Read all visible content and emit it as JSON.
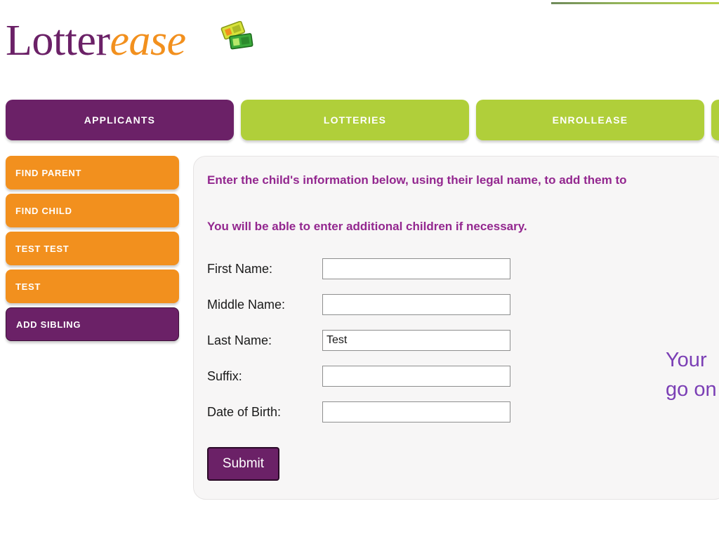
{
  "brand": {
    "logo_part_1": "Lotter",
    "logo_part_2": "ease",
    "ticket_icon": "lottery-ticket-icon"
  },
  "colors": {
    "purple": "#6b2167",
    "green": "#b0cf3a",
    "orange": "#f2901e",
    "heading_magenta": "#93278f",
    "note_purple": "#7b3fb5",
    "panel_bg": "#f7f6f6"
  },
  "tabs": [
    {
      "label": "APPLICANTS",
      "state": "active",
      "color": "purple"
    },
    {
      "label": "LOTTERIES",
      "state": "inactive",
      "color": "green"
    },
    {
      "label": "ENROLLEASE",
      "state": "inactive",
      "color": "green"
    },
    {
      "label": "",
      "state": "inactive",
      "color": "green"
    }
  ],
  "sidebar": {
    "items": [
      {
        "label": "FIND PARENT",
        "state": "inactive",
        "color": "orange"
      },
      {
        "label": "FIND CHILD",
        "state": "inactive",
        "color": "orange"
      },
      {
        "label": "TEST TEST",
        "state": "inactive",
        "color": "orange"
      },
      {
        "label": "TEST",
        "state": "inactive",
        "color": "orange"
      },
      {
        "label": "ADD SIBLING",
        "state": "active",
        "color": "purple"
      }
    ]
  },
  "panel": {
    "heading": "Enter the child's information below, using their legal name, to add them to",
    "subheading": "You will be able to enter additional children if necessary.",
    "form": {
      "fields": [
        {
          "label": "First Name:",
          "value": "",
          "placeholder": ""
        },
        {
          "label": "Middle Name:",
          "value": "",
          "placeholder": ""
        },
        {
          "label": "Last Name:",
          "value": "Test",
          "placeholder": ""
        },
        {
          "label": "Suffix:",
          "value": "",
          "placeholder": ""
        },
        {
          "label": "Date of Birth:",
          "value": "",
          "placeholder": ""
        }
      ],
      "submit_label": "Submit"
    }
  },
  "right_note": {
    "line_1": "Your",
    "line_2": "go on"
  }
}
